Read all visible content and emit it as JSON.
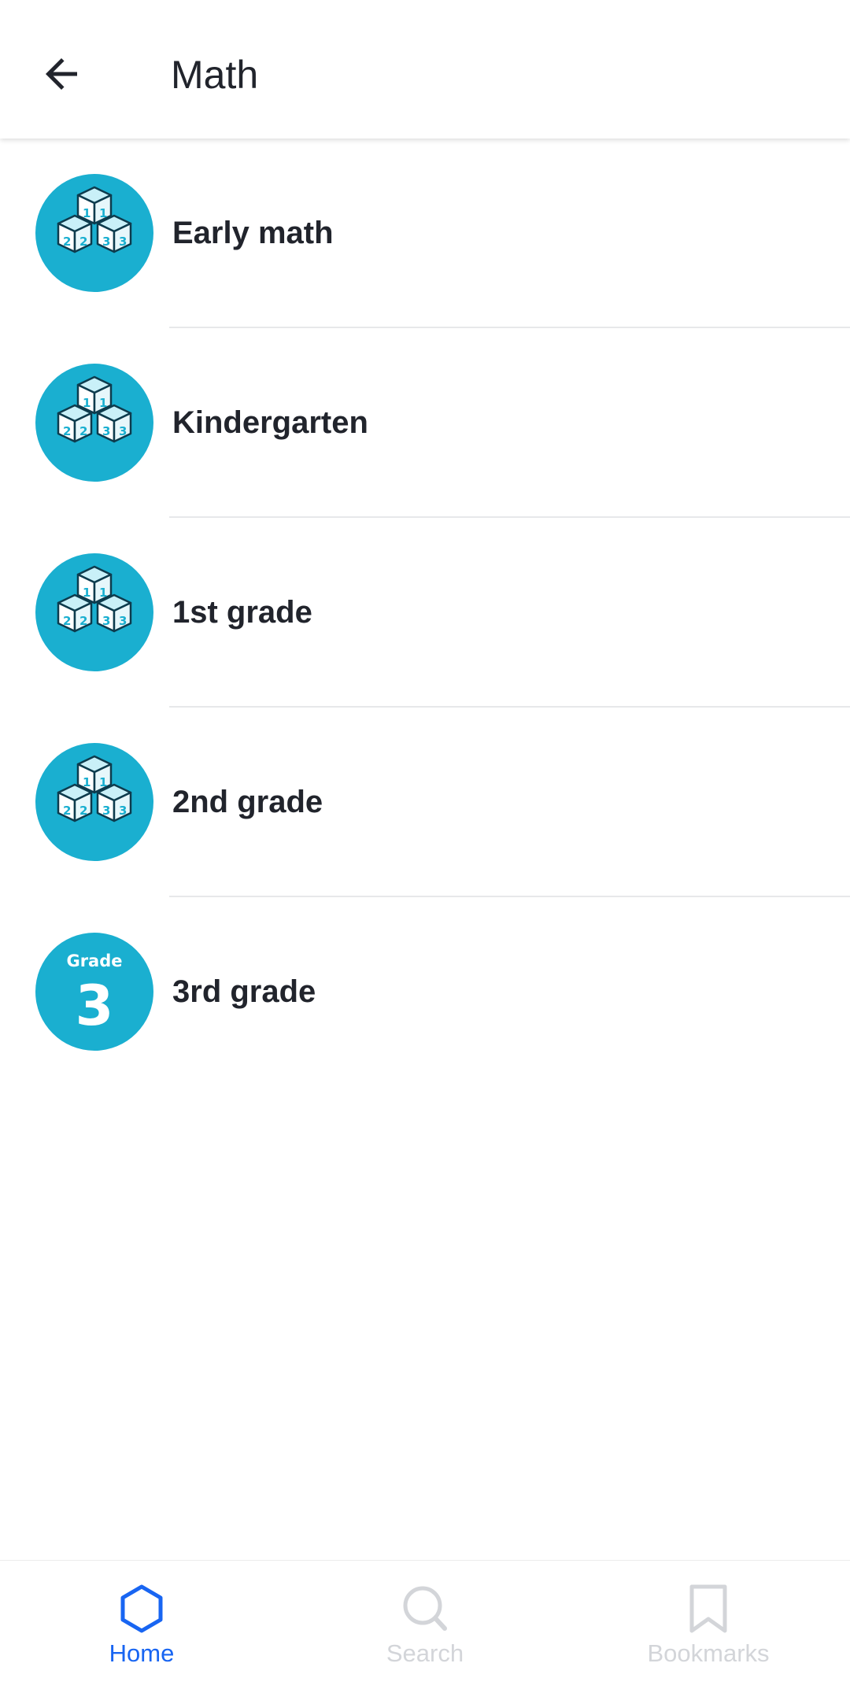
{
  "header": {
    "title": "Math",
    "back_icon": "arrow-left-icon"
  },
  "courses": [
    {
      "label": "Early math",
      "icon": "number-blocks-icon"
    },
    {
      "label": "Kindergarten",
      "icon": "number-blocks-icon"
    },
    {
      "label": "1st grade",
      "icon": "number-blocks-icon"
    },
    {
      "label": "2nd grade",
      "icon": "number-blocks-icon"
    },
    {
      "label": "3rd grade",
      "icon": "grade-3-badge-icon",
      "badge_top": "Grade",
      "badge_number": "3"
    }
  ],
  "nav": {
    "home": {
      "label": "Home",
      "icon": "hexagon-home-icon",
      "active": true
    },
    "search": {
      "label": "Search",
      "icon": "search-icon",
      "active": false
    },
    "bookmarks": {
      "label": "Bookmarks",
      "icon": "bookmark-icon",
      "active": false
    }
  },
  "colors": {
    "accent": "#1865f2",
    "avatar_bg": "#1aafd0",
    "inactive": "#d3d5d9",
    "text": "#21242c"
  }
}
